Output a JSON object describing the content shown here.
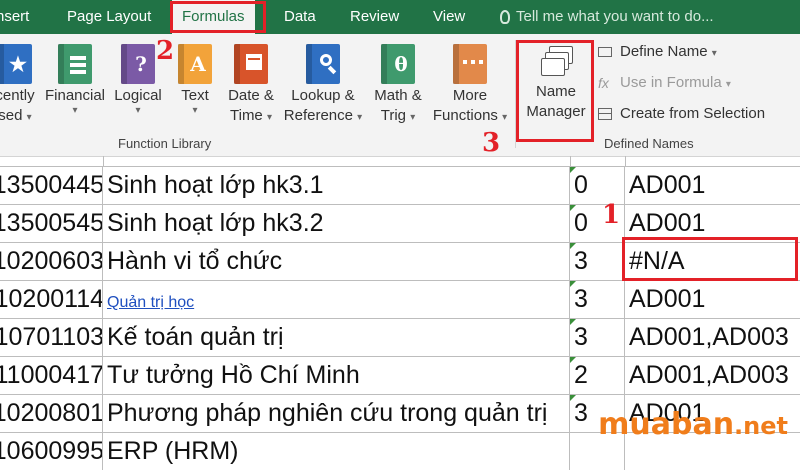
{
  "tabs": {
    "insert": "nsert",
    "page_layout": "Page Layout",
    "formulas": "Formulas",
    "data": "Data",
    "review": "Review",
    "view": "View"
  },
  "tell_me": "Tell me what you want to do...",
  "ribbon": {
    "function_library": {
      "label": "Function Library",
      "buttons": [
        {
          "line1": "cently",
          "line2": "sed",
          "icon": "star-icon",
          "color": "#2f6fc2"
        },
        {
          "line1": "Financial",
          "line2": "",
          "icon": "financial-book-icon",
          "color": "#3f9a6d"
        },
        {
          "line1": "Logical",
          "line2": "",
          "icon": "logical-book-icon",
          "color": "#7b5aa6"
        },
        {
          "line1": "Text",
          "line2": "",
          "icon": "text-book-icon",
          "color": "#f2a33a"
        },
        {
          "line1": "Date &",
          "line2": "Time",
          "icon": "date-time-book-icon",
          "color": "#d8542a"
        },
        {
          "line1": "Lookup &",
          "line2": "Reference",
          "icon": "lookup-book-icon",
          "color": "#2f6fc2"
        },
        {
          "line1": "Math &",
          "line2": "Trig",
          "icon": "math-book-icon",
          "color": "#3f9a6d"
        },
        {
          "line1": "More",
          "line2": "Functions",
          "icon": "more-functions-icon",
          "color": "#e2894a"
        }
      ],
      "glyphs": [
        "★",
        "",
        "?",
        "A",
        "",
        "",
        "θ",
        ""
      ]
    },
    "defined_names": {
      "label": "Defined Names",
      "name_manager_line1": "Name",
      "name_manager_line2": "Manager",
      "define_name": "Define Name",
      "use_in_formula": "Use in Formula",
      "create_from_selection": "Create from Selection"
    }
  },
  "steps": {
    "one": "1",
    "two": "2",
    "three": "3"
  },
  "rows": [
    {
      "code": "13500445",
      "name": "Sinh hoạt lớp hk3.1",
      "credits": "0",
      "group": "AD001",
      "link": false
    },
    {
      "code": "13500545",
      "name": "Sinh hoạt lớp hk3.2",
      "credits": "0",
      "group": "AD001",
      "link": false
    },
    {
      "code": "10200603",
      "name": "Hành vi tổ chức",
      "credits": "3",
      "group": "#N/A",
      "link": false
    },
    {
      "code": "10200114",
      "name": "Quản trị học",
      "credits": "3",
      "group": "AD001",
      "link": true
    },
    {
      "code": "10701103",
      "name": "Kế toán quản trị",
      "credits": "3",
      "group": "AD001,AD003",
      "link": false
    },
    {
      "code": "11000417",
      "name": "Tư tưởng Hồ Chí Minh",
      "credits": "2",
      "group": "AD001,AD003",
      "link": false
    },
    {
      "code": "10200801",
      "name": "Phương pháp nghiên cứu trong quản trị",
      "credits": "3",
      "group": "AD001",
      "link": false
    },
    {
      "code": "10600995",
      "name": "ERP (HRM)",
      "credits": "",
      "group": "",
      "link": false
    }
  ],
  "watermark": {
    "brand": "muaban",
    "tld": ".net"
  },
  "colors": {
    "excel_green": "#217346",
    "highlight_red": "#e32128",
    "watermark_orange": "#f07d1b"
  }
}
